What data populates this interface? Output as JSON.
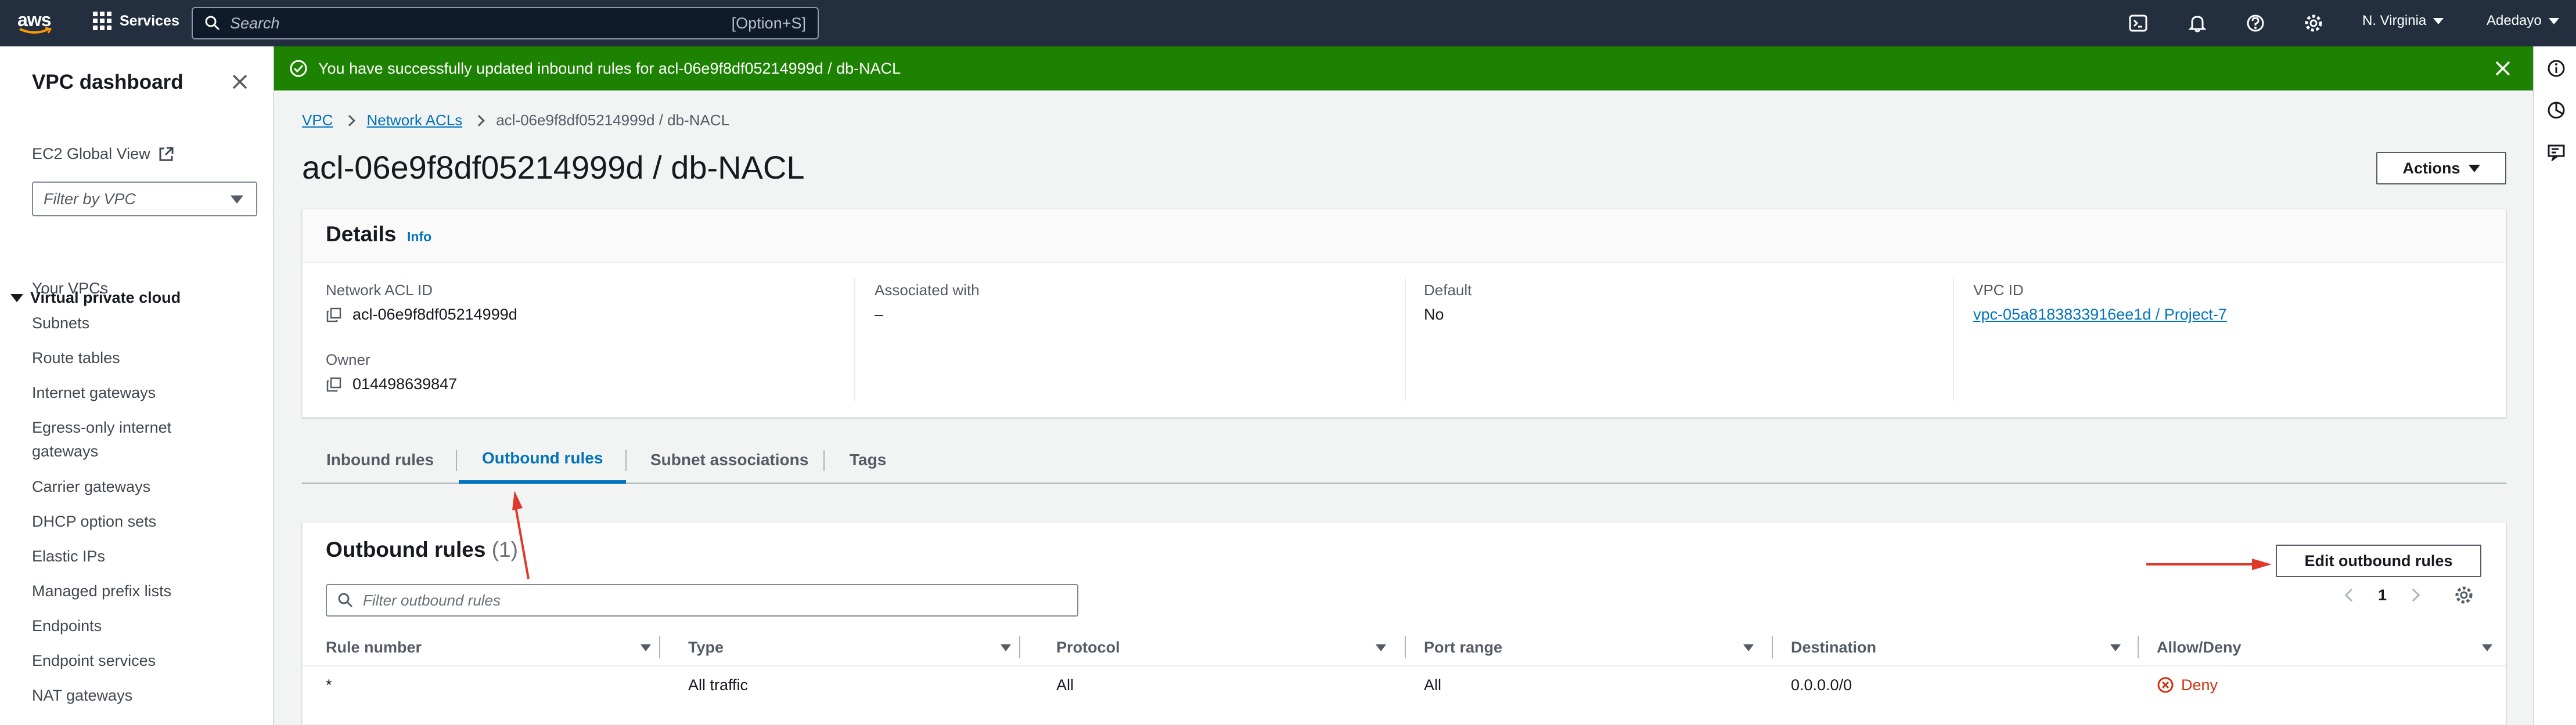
{
  "topnav": {
    "logo_text": "aws",
    "services_label": "Services",
    "search_placeholder": "Search",
    "search_shortcut": "[Option+S]",
    "region": "N. Virginia",
    "account": "Adedayo"
  },
  "sidenav": {
    "title": "VPC dashboard",
    "ec2_global_view": "EC2 Global View",
    "filter_placeholder": "Filter by VPC",
    "section": "Virtual private cloud",
    "items": [
      "Your VPCs",
      "Subnets",
      "Route tables",
      "Internet gateways",
      "Egress-only internet",
      "gateways",
      "Carrier gateways",
      "DHCP option sets",
      "Elastic IPs",
      "Managed prefix lists",
      "Endpoints",
      "Endpoint services",
      "NAT gateways"
    ]
  },
  "flash": {
    "message": "You have successfully updated inbound rules for acl-06e9f8df05214999d / db-NACL"
  },
  "breadcrumb": [
    "VPC",
    "Network ACLs",
    "acl-06e9f8df05214999d / db-NACL"
  ],
  "page": {
    "title": "acl-06e9f8df05214999d / db-NACL",
    "actions_label": "Actions"
  },
  "details": {
    "title": "Details",
    "info": "Info",
    "network_acl_id_label": "Network ACL ID",
    "network_acl_id": "acl-06e9f8df05214999d",
    "associated_with_label": "Associated with",
    "associated_with": "–",
    "default_label": "Default",
    "default": "No",
    "vpc_id_label": "VPC ID",
    "vpc_id": "vpc-05a8183833916ee1d / Project-7",
    "owner_label": "Owner",
    "owner": "014498639847"
  },
  "tabs": [
    "Inbound rules",
    "Outbound rules",
    "Subnet associations",
    "Tags"
  ],
  "outbound": {
    "title": "Outbound rules",
    "count": "(1)",
    "edit_label": "Edit outbound rules",
    "filter_placeholder": "Filter outbound rules",
    "page": "1",
    "columns": [
      "Rule number",
      "Type",
      "Protocol",
      "Port range",
      "Destination",
      "Allow/Deny"
    ],
    "rows": [
      {
        "rule_number": "*",
        "type": "All traffic",
        "protocol": "All",
        "port_range": "All",
        "destination": "0.0.0.0/0",
        "allow_deny": "Deny"
      }
    ]
  },
  "colors": {
    "nav_bg": "#232f3e",
    "success": "#1d8102",
    "link": "#0073bb",
    "deny": "#d13212",
    "annotation_arrow": "#e0392b"
  }
}
